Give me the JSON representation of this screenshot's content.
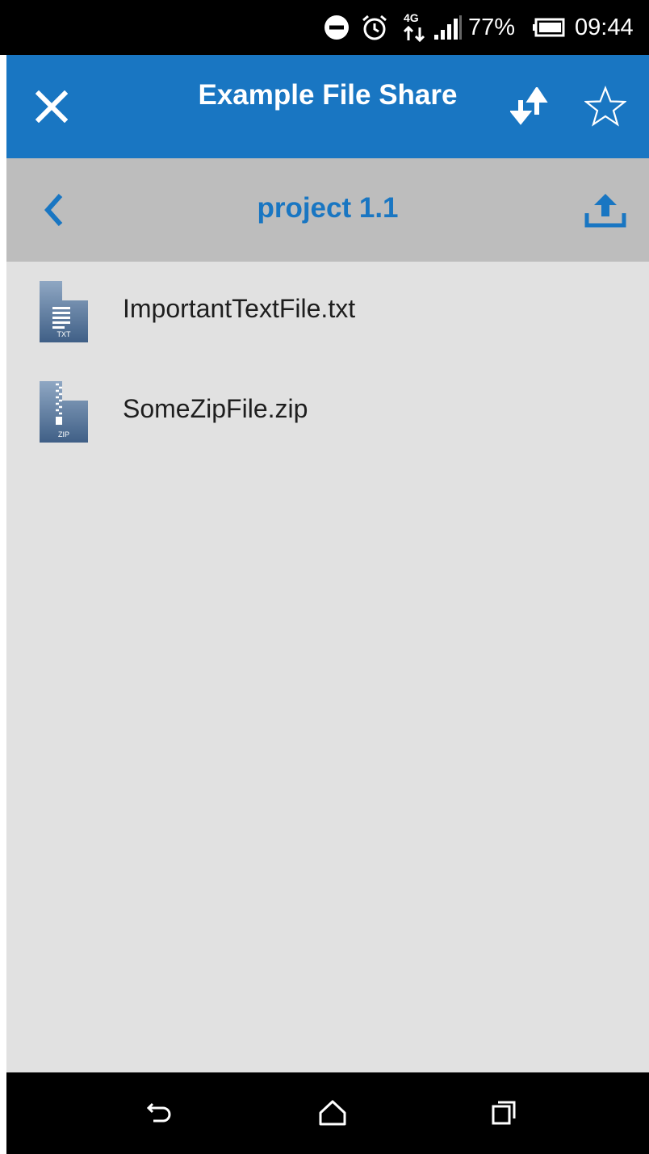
{
  "status_bar": {
    "battery_percent": "77%",
    "time": "09:44",
    "network_label": "4G"
  },
  "app_bar": {
    "title": "Example File Share",
    "icons": {
      "close": "close-icon",
      "sync": "sync-icon",
      "favorite": "star-outline-icon"
    }
  },
  "path_bar": {
    "folder_name": "project 1.1",
    "icons": {
      "back": "chevron-left-icon",
      "upload": "upload-icon"
    }
  },
  "files": [
    {
      "name": "ImportantTextFile.txt",
      "type_label": "TXT",
      "icon": "txt-file-icon"
    },
    {
      "name": "SomeZipFile.zip",
      "type_label": "ZIP",
      "icon": "zip-file-icon"
    }
  ],
  "colors": {
    "primary": "#1976c2",
    "path_bar_bg": "#bdbdbd",
    "content_bg": "#e1e1e1"
  }
}
